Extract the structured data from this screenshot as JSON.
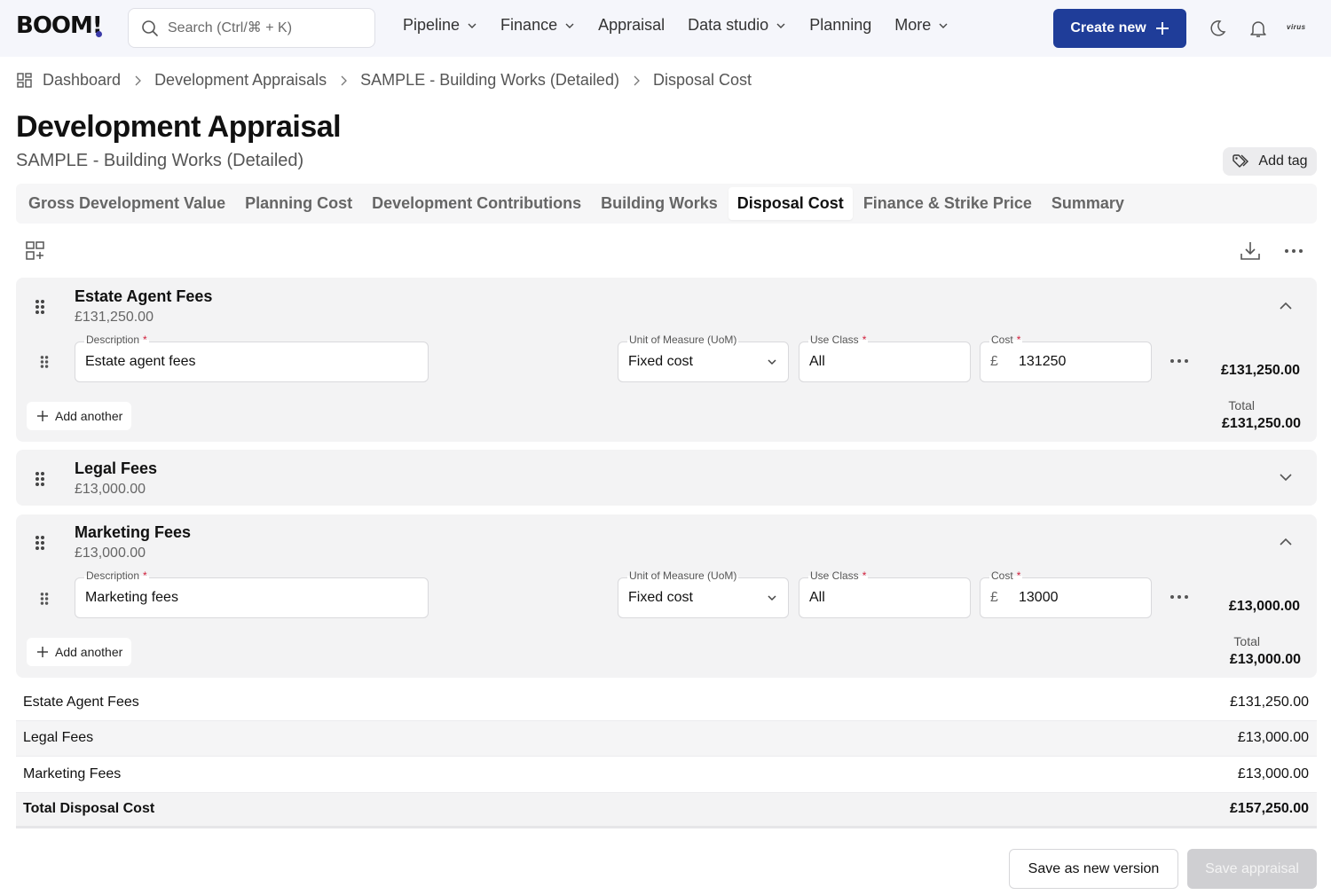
{
  "app": {
    "logo": "BOOM",
    "logo_bang": "!",
    "search_placeholder": "Search (Ctrl/⌘ + K)",
    "nav": [
      {
        "label": "Pipeline",
        "has_dropdown": true
      },
      {
        "label": "Finance",
        "has_dropdown": true
      },
      {
        "label": "Appraisal",
        "has_dropdown": false
      },
      {
        "label": "Data studio",
        "has_dropdown": true
      },
      {
        "label": "Planning",
        "has_dropdown": false
      },
      {
        "label": "More",
        "has_dropdown": true
      }
    ],
    "create_button": "Create new",
    "account_logo": "virus",
    "icons": {
      "theme": "moon-icon",
      "notifications": "bell-icon",
      "search": "search-icon"
    }
  },
  "breadcrumb": [
    "Dashboard",
    "Development Appraisals",
    "SAMPLE - Building Works (Detailed)",
    "Disposal Cost"
  ],
  "page": {
    "title": "Development Appraisal",
    "subtitle": "SAMPLE - Building Works (Detailed)",
    "add_tag": "Add tag"
  },
  "tabs": [
    {
      "label": "Gross Development Value",
      "active": false
    },
    {
      "label": "Planning Cost",
      "active": false
    },
    {
      "label": "Development Contributions",
      "active": false
    },
    {
      "label": "Building Works",
      "active": false
    },
    {
      "label": "Disposal Cost",
      "active": true
    },
    {
      "label": "Finance & Strike Price",
      "active": false
    },
    {
      "label": "Summary",
      "active": false
    }
  ],
  "field_labels": {
    "description": "Description",
    "uom": "Unit of Measure (UoM)",
    "use_class": "Use Class",
    "cost": "Cost",
    "required_mark": "*",
    "currency": "£",
    "total": "Total",
    "add_another": "Add another"
  },
  "sections": [
    {
      "title": "Estate Agent Fees",
      "amount": "£131,250.00",
      "expanded": true,
      "lines": [
        {
          "description": "Estate agent fees",
          "uom": "Fixed cost",
          "use_class": "All",
          "cost": "131250",
          "line_total": "£131,250.00"
        }
      ],
      "total": "£131,250.00"
    },
    {
      "title": "Legal Fees",
      "amount": "£13,000.00",
      "expanded": false,
      "lines": [],
      "total": "£13,000.00"
    },
    {
      "title": "Marketing Fees",
      "amount": "£13,000.00",
      "expanded": true,
      "lines": [
        {
          "description": "Marketing fees",
          "uom": "Fixed cost",
          "use_class": "All",
          "cost": "13000",
          "line_total": "£13,000.00"
        }
      ],
      "total": "£13,000.00"
    }
  ],
  "summary": {
    "rows": [
      {
        "label": "Estate Agent Fees",
        "value": "£131,250.00"
      },
      {
        "label": "Legal Fees",
        "value": "£13,000.00"
      },
      {
        "label": "Marketing Fees",
        "value": "£13,000.00"
      }
    ],
    "total": {
      "label": "Total Disposal Cost",
      "value": "£157,250.00"
    }
  },
  "footer": {
    "save_new_version": "Save as new version",
    "save_appraisal": "Save appraisal"
  }
}
